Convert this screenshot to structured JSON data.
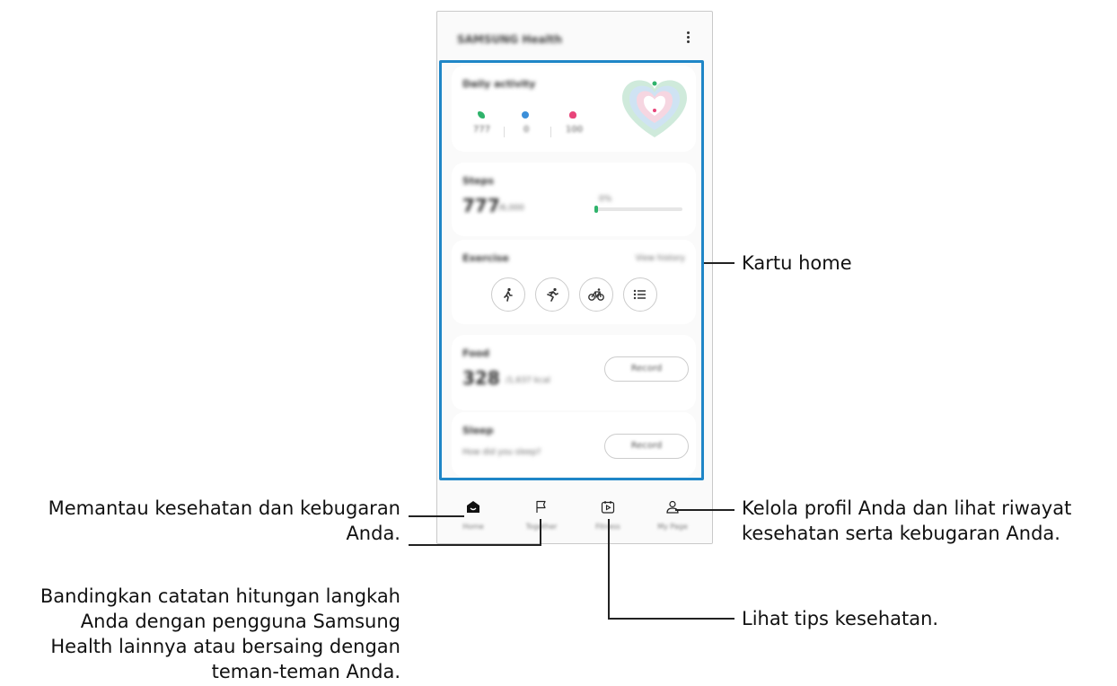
{
  "app": {
    "title": "SAMSUNG Health"
  },
  "cards": {
    "daily_activity": {
      "title": "Daily activity",
      "stats": [
        {
          "icon": "steps-icon",
          "value": "777",
          "color": "#2fb36b"
        },
        {
          "icon": "active-time-icon",
          "value": "0",
          "color": "#3b8fd9"
        },
        {
          "icon": "calories-icon",
          "value": "100",
          "color": "#e8457a"
        }
      ]
    },
    "steps": {
      "title": "Steps",
      "value": "777",
      "unit": "/6,000",
      "target": "0%",
      "progress": 0.02
    },
    "exercise": {
      "title": "Exercise",
      "link": "View history",
      "buttons": [
        "walking-icon",
        "running-icon",
        "cycling-icon",
        "list-icon"
      ]
    },
    "food": {
      "title": "Food",
      "value": "328",
      "unit": "/1,637 kcal",
      "button": "Record"
    },
    "sleep": {
      "title": "Sleep",
      "prompt": "How did you sleep?",
      "button": "Record"
    }
  },
  "nav": [
    {
      "icon": "home-icon",
      "label": "Home"
    },
    {
      "icon": "flag-icon",
      "label": "Together"
    },
    {
      "icon": "fitness-video-icon",
      "label": "Fitness"
    },
    {
      "icon": "person-icon",
      "label": "My Page"
    }
  ],
  "annotations": {
    "home_cards": "Kartu home",
    "monitor": [
      "Memantau kesehatan dan kebugaran",
      "Anda."
    ],
    "profile": [
      "Kelola profil Anda dan lihat riwayat",
      "kesehatan serta kebugaran Anda."
    ],
    "compare": [
      "Bandingkan catatan hitungan langkah",
      "Anda dengan pengguna Samsung",
      "Health lainnya atau bersaing dengan",
      "teman-teman Anda."
    ],
    "tips": "Lihat tips kesehatan."
  },
  "colors": {
    "highlight": "#1f86c7",
    "accent_green": "#2fb36b"
  }
}
